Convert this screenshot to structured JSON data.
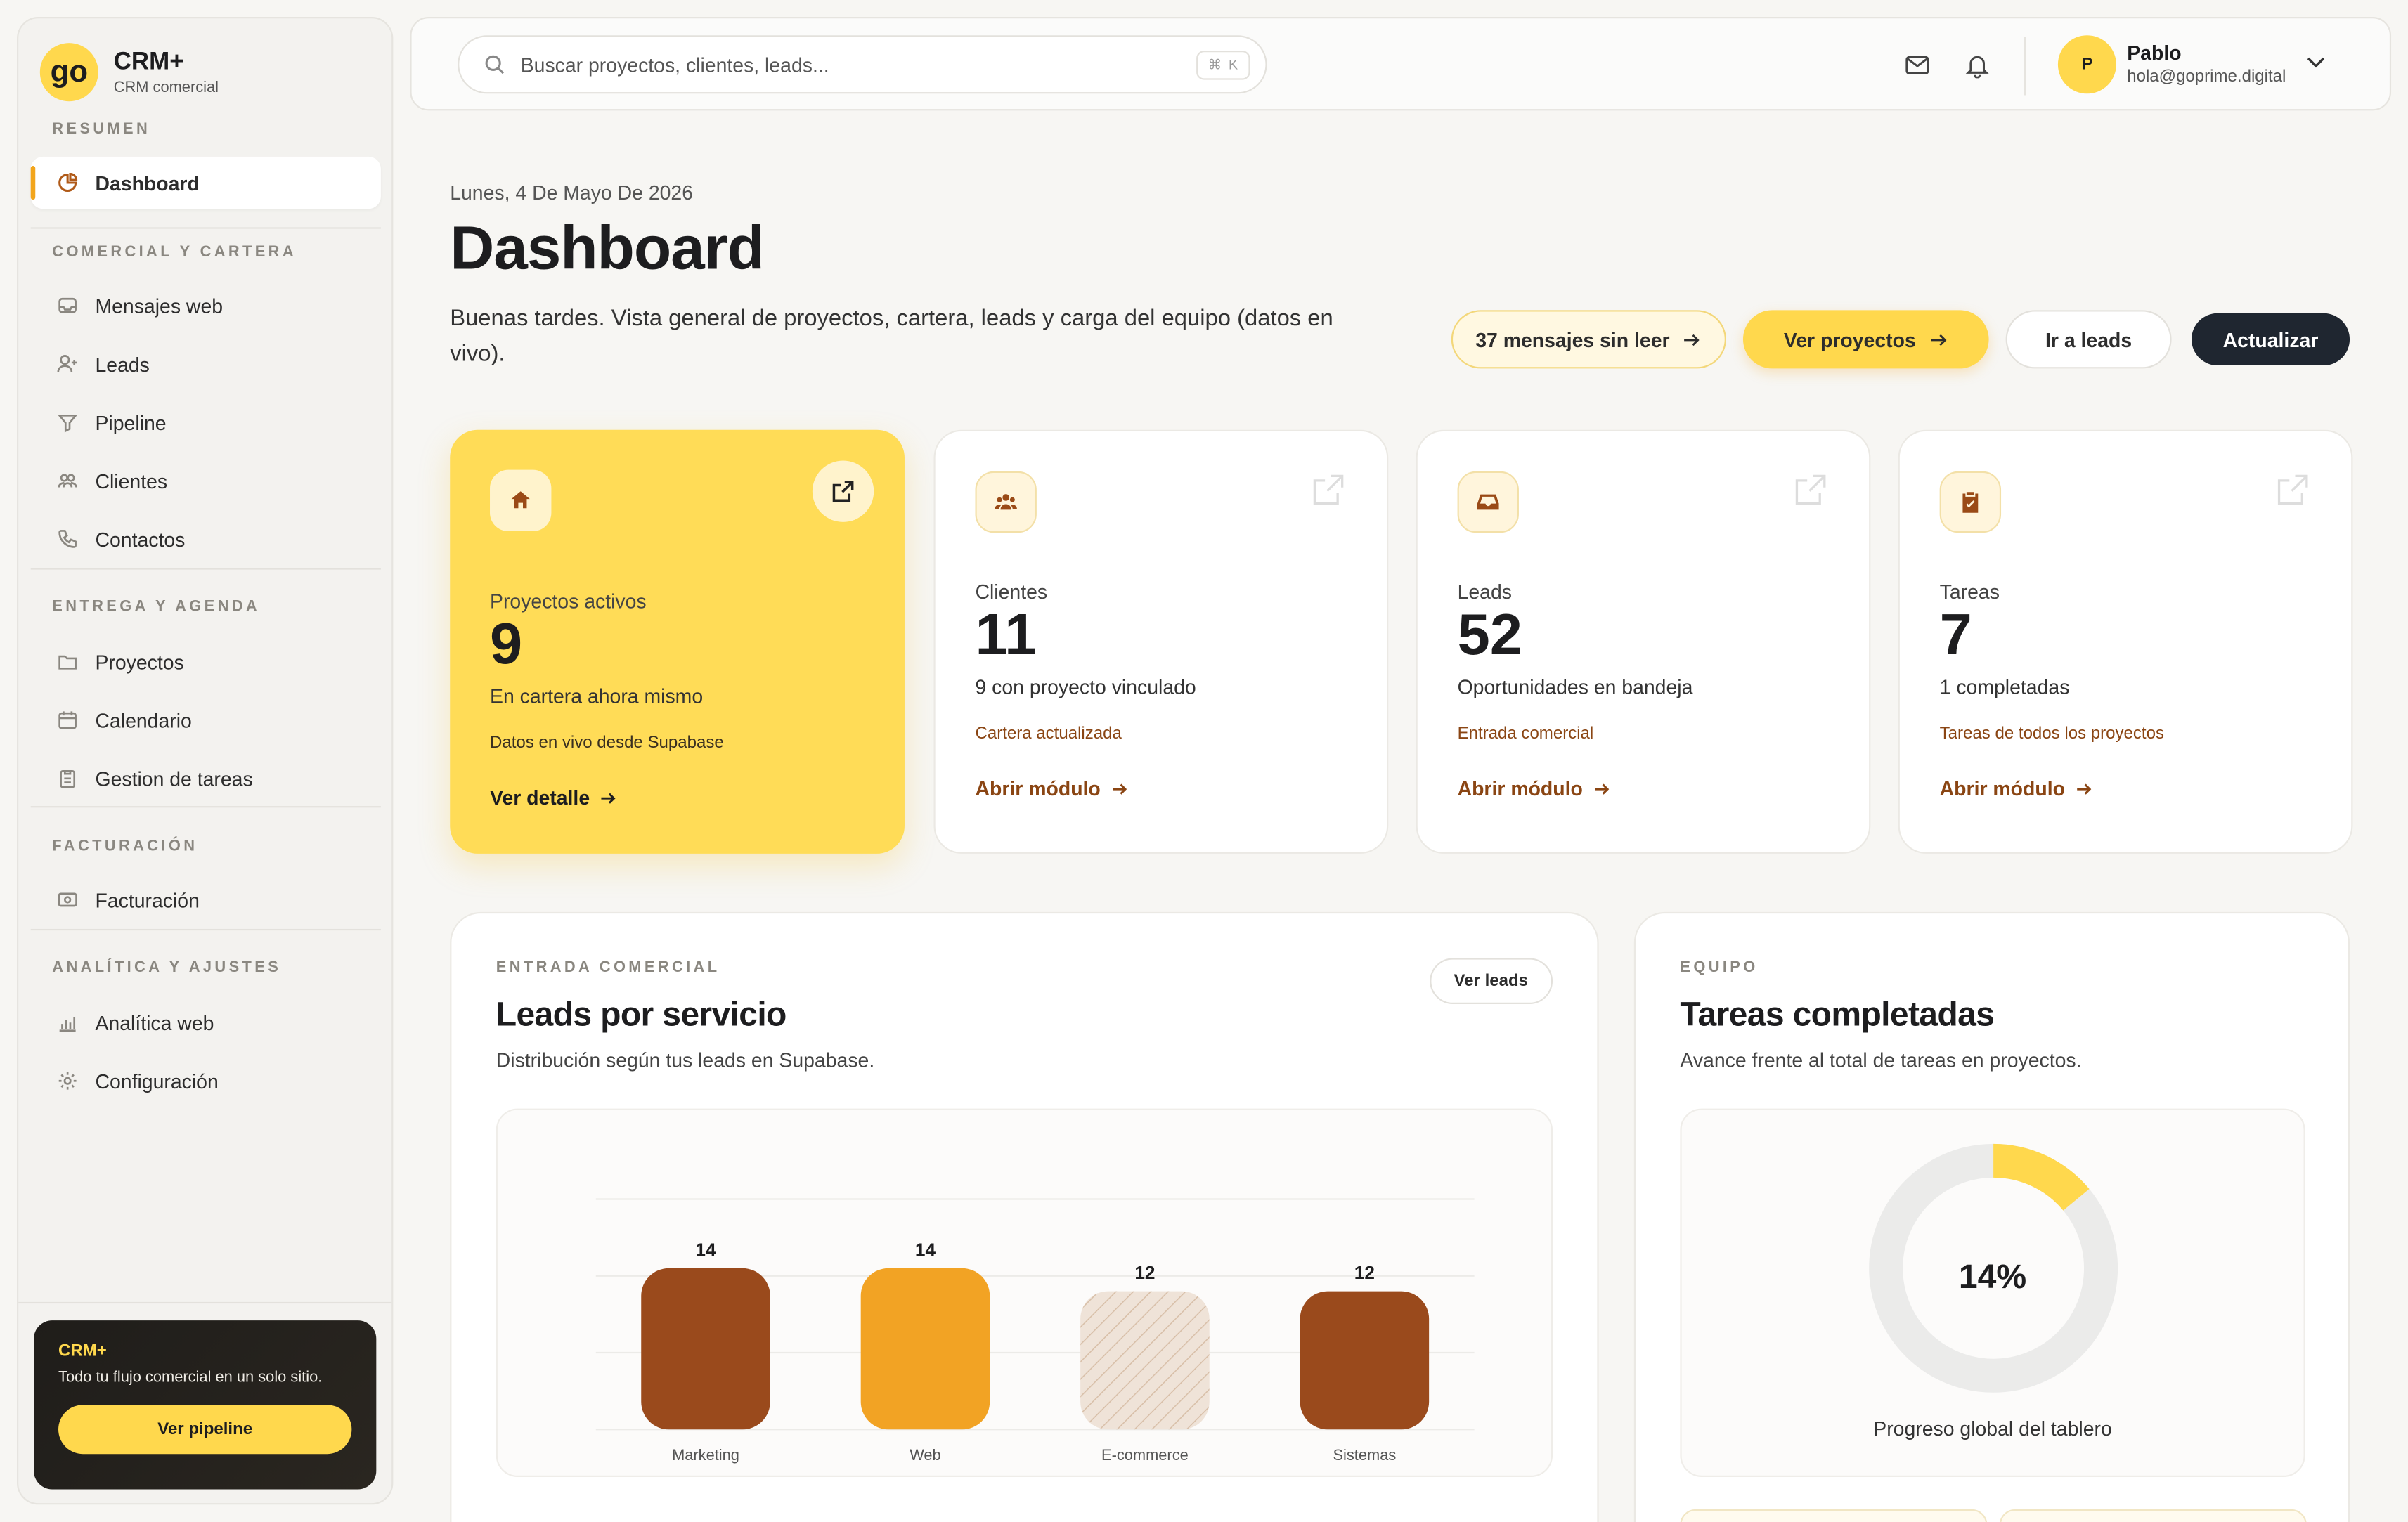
{
  "brand": {
    "logo": "go",
    "name": "CRM+",
    "sub": "CRM comercial"
  },
  "sidebar": {
    "sections": [
      {
        "title": "RESUMEN"
      },
      {
        "title": "COMERCIAL Y CARTERA"
      },
      {
        "title": "ENTREGA Y AGENDA"
      },
      {
        "title": "FACTURACIÓN"
      },
      {
        "title": "ANALÍTICA Y AJUSTES"
      }
    ],
    "items": [
      {
        "label": "Dashboard",
        "icon": "pie-chart-icon",
        "active": true
      },
      {
        "label": "Mensajes web",
        "icon": "inbox-icon"
      },
      {
        "label": "Leads",
        "icon": "user-plus-icon"
      },
      {
        "label": "Pipeline",
        "icon": "funnel-icon"
      },
      {
        "label": "Clientes",
        "icon": "users-icon"
      },
      {
        "label": "Contactos",
        "icon": "phone-icon"
      },
      {
        "label": "Proyectos",
        "icon": "folder-icon"
      },
      {
        "label": "Calendario",
        "icon": "calendar-icon"
      },
      {
        "label": "Gestion de tareas",
        "icon": "clipboard-icon"
      },
      {
        "label": "Facturación",
        "icon": "invoice-icon"
      },
      {
        "label": "Analítica web",
        "icon": "bar-chart-icon"
      },
      {
        "label": "Configuración",
        "icon": "gear-icon"
      }
    ],
    "promo": {
      "title": "CRM+",
      "text": "Todo tu flujo comercial en un solo sitio.",
      "button": "Ver pipeline"
    }
  },
  "topbar": {
    "search_placeholder": "Buscar proyectos, clientes, leads...",
    "shortcut": "⌘ K",
    "user": {
      "initial": "P",
      "name": "Pablo",
      "email": "hola@goprime.digital"
    }
  },
  "header": {
    "date": "Lunes, 4 De Mayo De 2026",
    "title": "Dashboard",
    "subtitle": "Buenas tardes. Vista general de proyectos, cartera, leads y carga del equipo (datos en vivo).",
    "buttons": {
      "messages": "37 mensajes sin leer",
      "projects": "Ver proyectos",
      "leads": "Ir a leads",
      "refresh": "Actualizar"
    }
  },
  "kpis": [
    {
      "label": "Proyectos activos",
      "value": "9",
      "desc": "En cartera ahora mismo",
      "note": "Datos en vivo desde Supabase",
      "link": "Ver detalle",
      "icon": "home-icon"
    },
    {
      "label": "Clientes",
      "value": "11",
      "desc": "9 con proyecto vinculado",
      "note": "Cartera actualizada",
      "link": "Abrir módulo",
      "icon": "users-icon"
    },
    {
      "label": "Leads",
      "value": "52",
      "desc": "Oportunidades en bandeja",
      "note": "Entrada comercial",
      "link": "Abrir módulo",
      "icon": "inbox-icon"
    },
    {
      "label": "Tareas",
      "value": "7",
      "desc": "1 completadas",
      "note": "Tareas de todos los proyectos",
      "link": "Abrir módulo",
      "icon": "clipboard-check-icon"
    }
  ],
  "leads_panel": {
    "eyebrow": "ENTRADA COMERCIAL",
    "title": "Leads por servicio",
    "subtitle": "Distribución según tus leads en Supabase.",
    "button": "Ver leads"
  },
  "tasks_panel": {
    "eyebrow": "EQUIPO",
    "title": "Tareas completadas",
    "subtitle": "Avance frente al total de tareas en proyectos.",
    "percent_label": "14%",
    "percent": 14,
    "caption": "Progreso global del tablero"
  },
  "chart_data": {
    "type": "bar",
    "categories": [
      "Marketing",
      "Web",
      "E-commerce",
      "Sistemas"
    ],
    "values": [
      14,
      14,
      12,
      12
    ],
    "ylim": [
      0,
      20
    ],
    "grid": true,
    "colors": [
      "#9a4a1c",
      "#f2a324",
      "#efe3d8",
      "#9a4a1c"
    ],
    "patterns": [
      "solid",
      "solid",
      "hatched",
      "solid"
    ]
  },
  "colors": {
    "accent": "#ffd84d",
    "brand_brown": "#9a4a1c",
    "dark": "#1f2630"
  }
}
